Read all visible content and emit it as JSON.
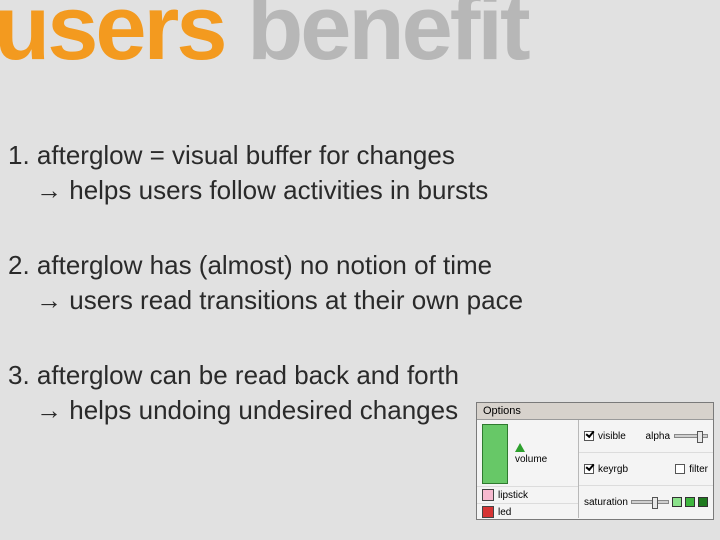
{
  "title": {
    "word1": "users",
    "word2": "benefit"
  },
  "items": [
    {
      "num": "1.",
      "line1": "afterglow = visual buffer for changes",
      "arrow": "→",
      "line2": "helps users follow activities in bursts"
    },
    {
      "num": "2.",
      "line1": "afterglow has (almost) no notion of time",
      "arrow": "→",
      "line2": "users read transitions at their own pace"
    },
    {
      "num": "3.",
      "line1": "afterglow can be read back and forth",
      "arrow": "→",
      "line2": "helps undoing undesired changes"
    }
  ],
  "panel": {
    "title": "Options",
    "left": {
      "volume": "volume",
      "lipstick": "lipstick",
      "led": "led"
    },
    "right": {
      "visible": "visible",
      "keyrgb": "keyrgb",
      "filter": "filter",
      "alpha": "alpha",
      "saturation": "saturation"
    }
  }
}
